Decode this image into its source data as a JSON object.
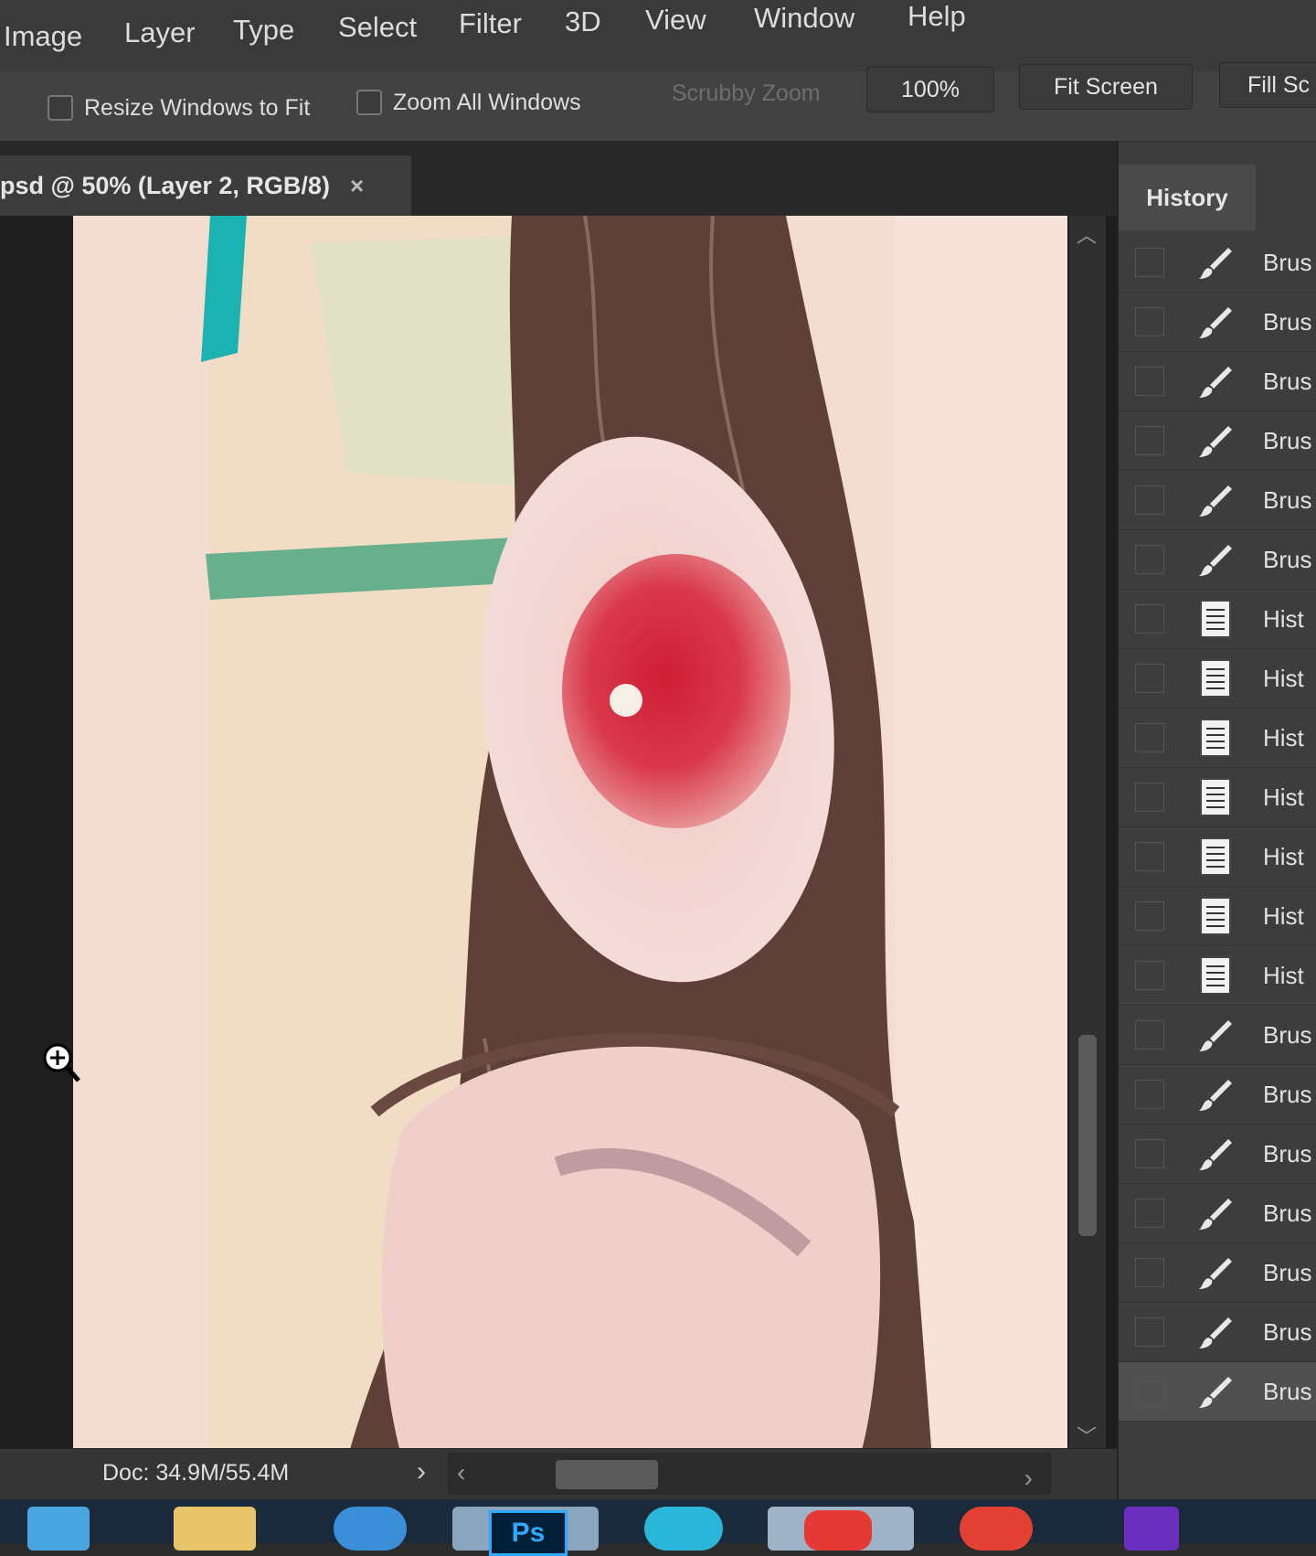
{
  "menu": [
    "Image",
    "Layer",
    "Type",
    "Select",
    "Filter",
    "3D",
    "View",
    "Window",
    "Help"
  ],
  "options": {
    "resize_windows_label": "Resize Windows to Fit",
    "zoom_all_label": "Zoom All Windows",
    "scrubby_zoom_label": "Scrubby Zoom",
    "zoom_value": "100%",
    "fit_screen_label": "Fit Screen",
    "fill_screen_label": "Fill Sc"
  },
  "document": {
    "tab_title": "psd @ 50% (Layer 2, RGB/8)",
    "close_glyph": "×",
    "doc_size": "Doc: 34.9M/55.4M"
  },
  "history": {
    "panel_title": "History",
    "items": [
      {
        "label": "Brus",
        "icon": "brush-icon"
      },
      {
        "label": "Brus",
        "icon": "brush-icon"
      },
      {
        "label": "Brus",
        "icon": "brush-icon"
      },
      {
        "label": "Brus",
        "icon": "brush-icon"
      },
      {
        "label": "Brus",
        "icon": "brush-icon"
      },
      {
        "label": "Brus",
        "icon": "brush-icon"
      },
      {
        "label": "Hist",
        "icon": "document-icon"
      },
      {
        "label": "Hist",
        "icon": "document-icon"
      },
      {
        "label": "Hist",
        "icon": "document-icon"
      },
      {
        "label": "Hist",
        "icon": "document-icon"
      },
      {
        "label": "Hist",
        "icon": "document-icon"
      },
      {
        "label": "Hist",
        "icon": "document-icon"
      },
      {
        "label": "Hist",
        "icon": "document-icon"
      },
      {
        "label": "Brus",
        "icon": "brush-icon"
      },
      {
        "label": "Brus",
        "icon": "brush-icon"
      },
      {
        "label": "Brus",
        "icon": "brush-icon"
      },
      {
        "label": "Brus",
        "icon": "brush-icon"
      },
      {
        "label": "Brus",
        "icon": "brush-icon"
      },
      {
        "label": "Brus",
        "icon": "brush-icon"
      },
      {
        "label": "Brus",
        "icon": "brush-icon"
      }
    ]
  },
  "taskbar": {
    "apps": [
      "media-player-icon",
      "file-explorer-icon",
      "browser-icon",
      "photoshop-icon",
      "video-app-icon",
      "app-icon",
      "chrome-icon"
    ],
    "photoshop_label": "Ps"
  },
  "colors": {
    "accent_teal": "#1bb3b1",
    "accent_green": "#3aa27a",
    "paint_red": "#d6233a",
    "hair_brown": "#5f4038",
    "skin_pink": "#f3d7d2"
  }
}
